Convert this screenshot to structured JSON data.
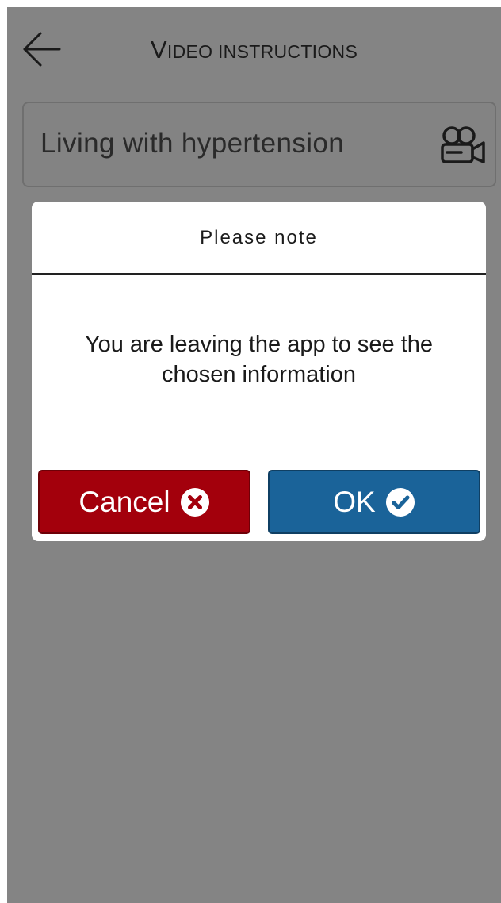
{
  "header": {
    "title_cap": "V",
    "title_rest": "IDEO INSTRUCTIONS",
    "back_icon": "arrow-left-icon"
  },
  "video_row": {
    "label": "Living with hypertension",
    "icon": "video-camera-icon"
  },
  "dialog": {
    "title": "Please note",
    "message": "You are leaving the app to see the chosen information",
    "cancel_label": "Cancel",
    "cancel_icon": "close-circle-icon",
    "ok_label": "OK",
    "ok_icon": "check-circle-icon"
  },
  "colors": {
    "overlay": "#848484",
    "cancel": "#a3000c",
    "ok": "#1a6399"
  }
}
